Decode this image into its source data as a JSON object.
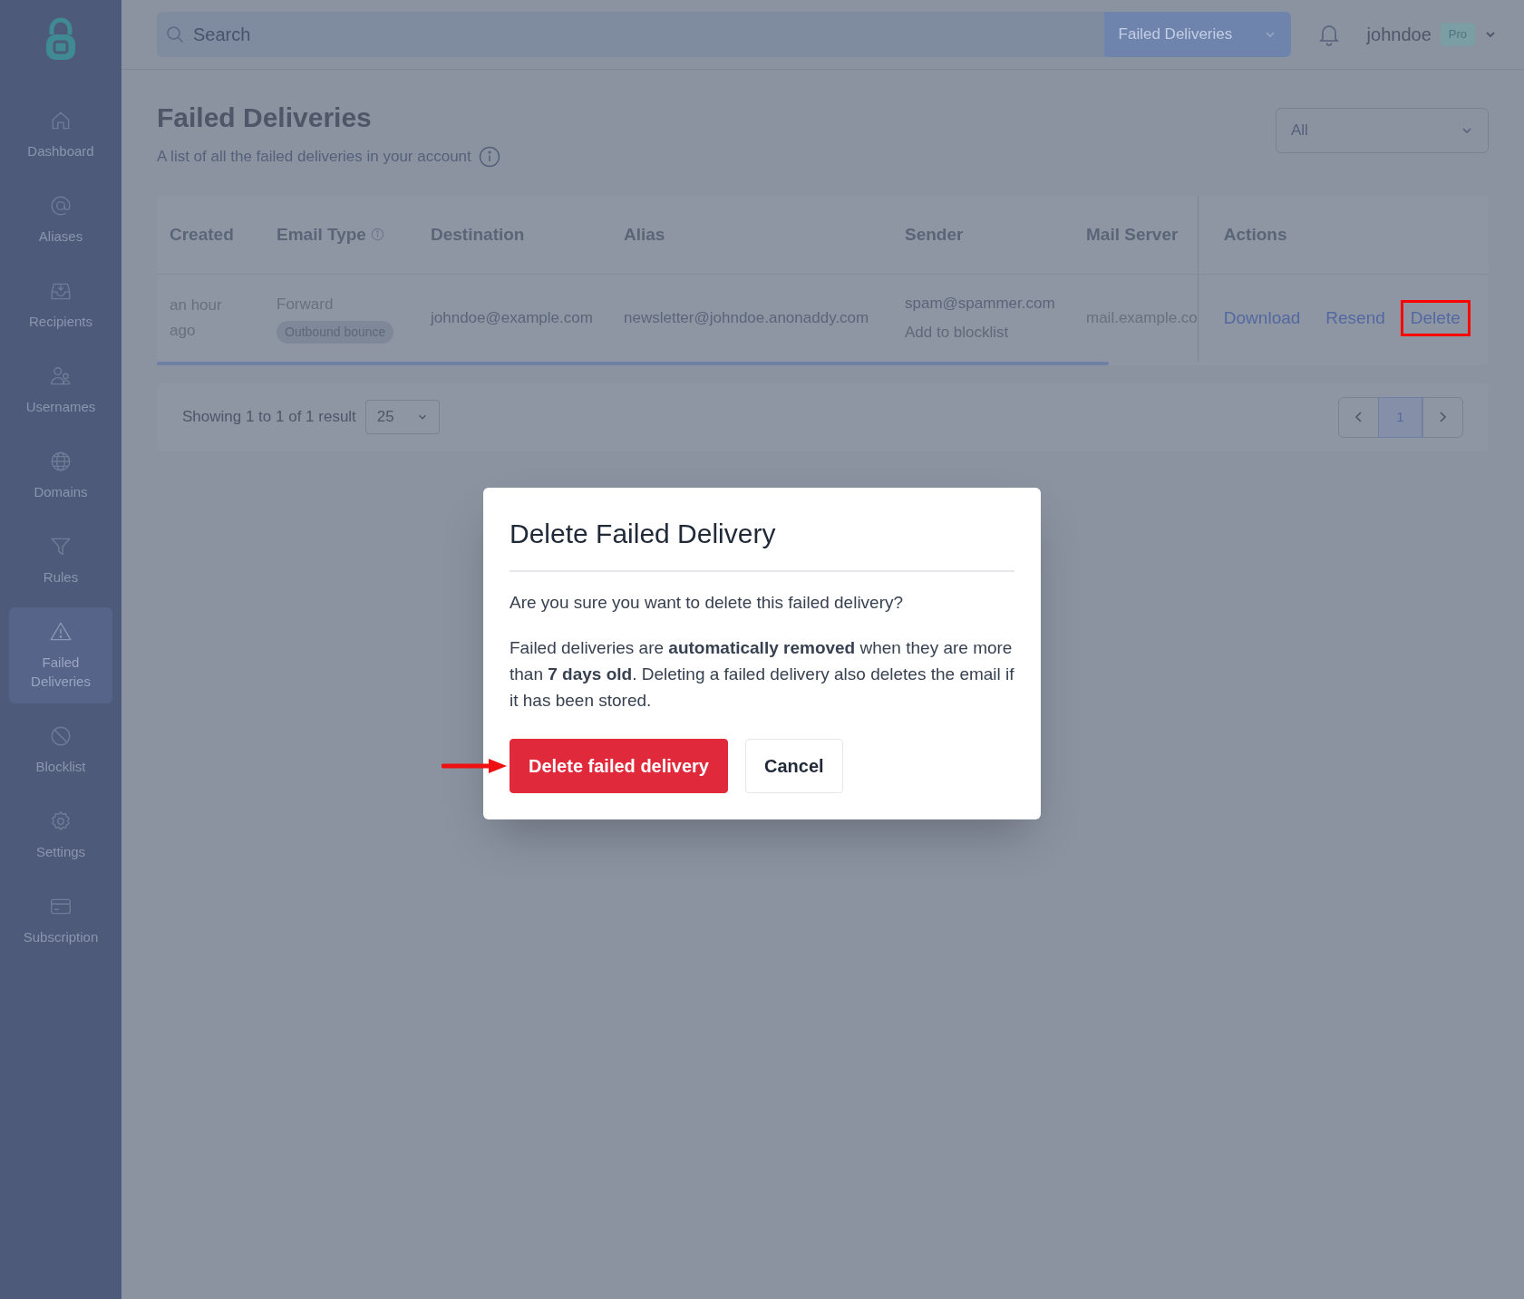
{
  "sidebar": {
    "items": [
      {
        "label": "Dashboard",
        "selected": false
      },
      {
        "label": "Aliases",
        "selected": false
      },
      {
        "label": "Recipients",
        "selected": false
      },
      {
        "label": "Usernames",
        "selected": false
      },
      {
        "label": "Domains",
        "selected": false
      },
      {
        "label": "Rules",
        "selected": false
      },
      {
        "label": "Failed Deliveries",
        "selected": true
      },
      {
        "label": "Blocklist",
        "selected": false
      },
      {
        "label": "Settings",
        "selected": false
      },
      {
        "label": "Subscription",
        "selected": false
      }
    ]
  },
  "topbar": {
    "search": {
      "placeholder": "Search"
    },
    "scope": "Failed Deliveries",
    "username": "johndoe",
    "plan_badge": "Pro"
  },
  "page": {
    "title": "Failed Deliveries",
    "subtitle": "A list of all the failed deliveries in your account",
    "filter": "All"
  },
  "table": {
    "columns": [
      "Created",
      "Email Type",
      "Destination",
      "Alias",
      "Sender",
      "Mail Server",
      "Actions"
    ],
    "rows": [
      {
        "created": "an hour ago",
        "email_type": "Forward",
        "bounce_badge": "Outbound bounce",
        "destination": "johndoe@example.com",
        "alias": "newsletter@johndoe.anonaddy.com",
        "sender": "spam@spammer.com",
        "sender_action": "Add to blocklist",
        "mail_server": "mail.example.co",
        "actions": [
          {
            "label": "Download",
            "highlighted": false
          },
          {
            "label": "Resend",
            "highlighted": false
          },
          {
            "label": "Delete",
            "highlighted": true
          }
        ]
      }
    ]
  },
  "pagination": {
    "summary": "Showing 1 to 1 of 1 result",
    "per_page": "25",
    "pages": [
      {
        "label": "1",
        "selected": true
      }
    ]
  },
  "modal": {
    "title": "Delete Failed Delivery",
    "question": "Are you sure you want to delete this failed delivery?",
    "note": "Failed deliveries are **automatically removed** when they are more than **7 days old**. Deleting a failed delivery also deletes the email if it has been stored.",
    "pointer_arrow": true,
    "buttons": [
      {
        "label": "Delete failed delivery",
        "kind": "danger"
      },
      {
        "label": "Cancel",
        "kind": "secondary"
      }
    ]
  }
}
